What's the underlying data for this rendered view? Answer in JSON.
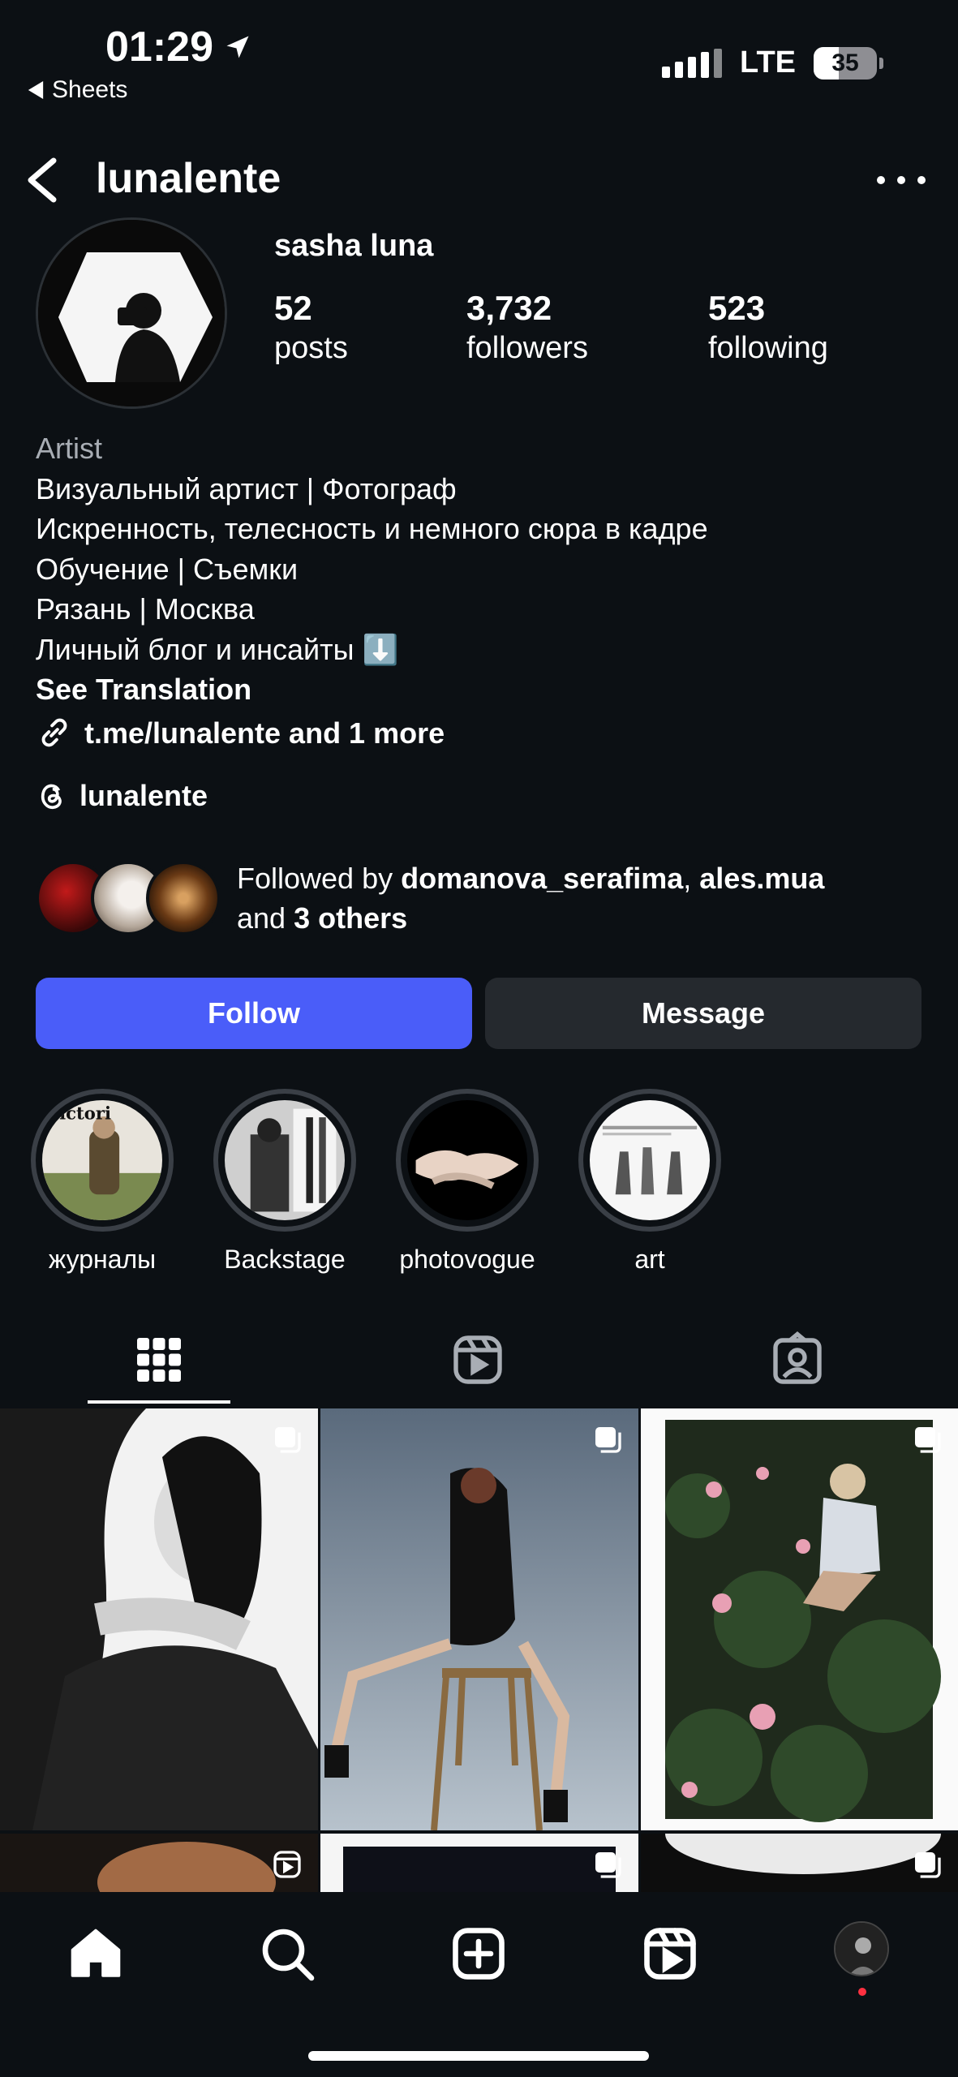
{
  "status_bar": {
    "time": "01:29",
    "back_app": "Sheets",
    "network": "LTE",
    "battery": "35"
  },
  "header": {
    "username": "lunalente"
  },
  "profile": {
    "display_name": "sasha luna",
    "stats": [
      {
        "value": "52",
        "label": "posts"
      },
      {
        "value": "3,732",
        "label": "followers"
      },
      {
        "value": "523",
        "label": "following"
      }
    ],
    "category": "Artist",
    "bio_lines": [
      "Визуальный артист | Фотограф",
      "Искренность, телесность и немного сюра в кадре",
      "Обучение | Съемки",
      "Рязань | Москва",
      "Личный блог и инсайты ⬇️"
    ],
    "see_translation": "See Translation",
    "link": "t.me/lunalente and 1 more",
    "threads": "lunalente"
  },
  "followed_by": {
    "prefix": "Followed by ",
    "user1": "domanova_serafima",
    "sep": ", ",
    "user2": "ales.mua",
    "and": "and ",
    "others": "3 others"
  },
  "actions": {
    "follow": "Follow",
    "message": "Message"
  },
  "highlights": [
    {
      "label": "журналы"
    },
    {
      "label": "Backstage"
    },
    {
      "label": "photovogue"
    },
    {
      "label": "art"
    }
  ],
  "tabs": [
    {
      "icon": "grid-icon",
      "active": true
    },
    {
      "icon": "reels-icon",
      "active": false
    },
    {
      "icon": "tagged-icon",
      "active": false
    }
  ],
  "bottom_nav": [
    {
      "icon": "home-icon"
    },
    {
      "icon": "search-icon"
    },
    {
      "icon": "create-icon"
    },
    {
      "icon": "reels-icon"
    },
    {
      "icon": "profile-avatar"
    }
  ],
  "colors": {
    "background": "#0c1014",
    "follow_button": "#4a5df9",
    "message_button": "#25292e",
    "secondary_text": "#a8adb4",
    "notification_dot": "#ff3040"
  }
}
